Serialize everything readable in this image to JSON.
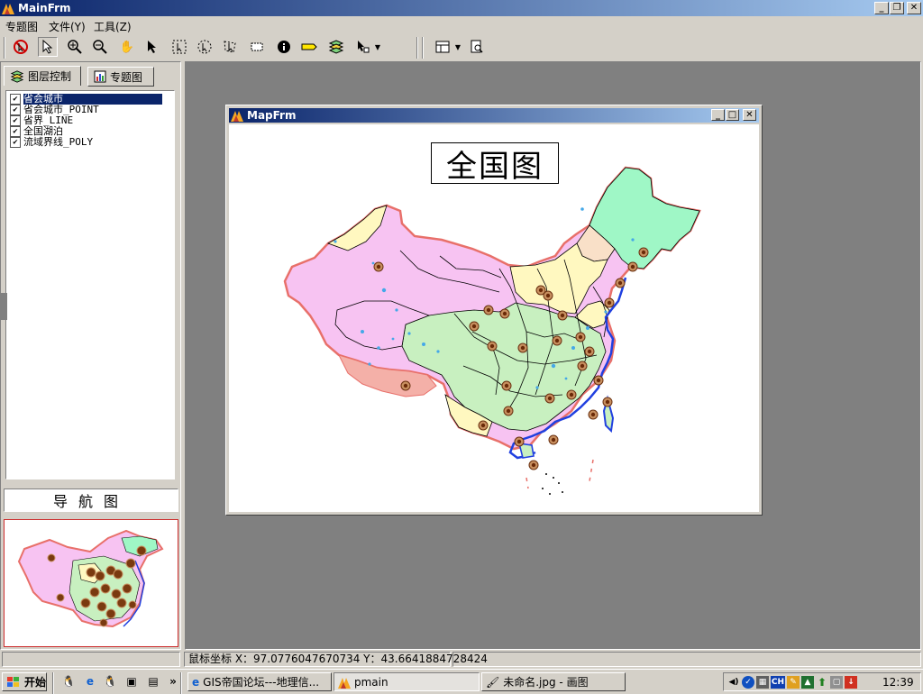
{
  "window": {
    "title": "MainFrm"
  },
  "menu": [
    "专题图",
    "文件(Y)",
    "工具(Z)"
  ],
  "left_tabs": {
    "layers": "图层控制",
    "thematic": "专题图"
  },
  "layers": [
    {
      "label": "省会城市",
      "checked": true,
      "selected": true
    },
    {
      "label": "省会城市_POINT",
      "checked": true,
      "selected": false
    },
    {
      "label": "省界_LINE",
      "checked": true,
      "selected": false
    },
    {
      "label": "全国湖泊",
      "checked": true,
      "selected": false
    },
    {
      "label": "流域界线_POLY",
      "checked": true,
      "selected": false
    }
  ],
  "nav": {
    "title": "导航图"
  },
  "map_window": {
    "title": "MapFrm",
    "map_title": "全国图"
  },
  "status": {
    "coords": "鼠标坐标 X：97.0776047670734 Y：43.6641884728424"
  },
  "taskbar": {
    "start": "开始",
    "tasks": [
      {
        "label": "GIS帝国论坛---地理信...",
        "active": false
      },
      {
        "label": "pmain",
        "active": true
      },
      {
        "label": "未命名.jpg - 画图",
        "active": false
      }
    ],
    "tray_lang": "CH",
    "clock": "12:39"
  },
  "colors": {
    "title_gradient_start": "#0a246a",
    "title_gradient_end": "#a6caf0",
    "selection": "#0a246a",
    "map_border": "#e8706a",
    "coast": "#2040e0"
  }
}
